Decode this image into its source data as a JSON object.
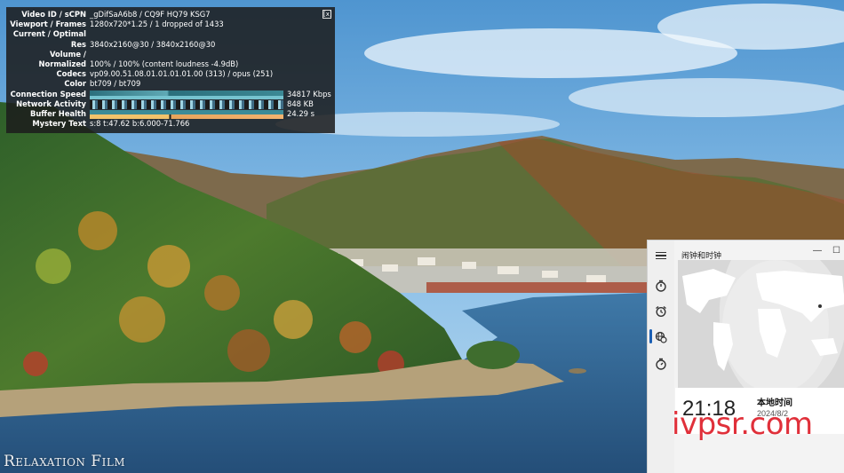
{
  "stats": {
    "close_label": "[x]",
    "rows": [
      {
        "key": "Video ID / sCPN",
        "value": "_gDifSaA6b8 / CQ9F HQ79 KSG7"
      },
      {
        "key": "Viewport / Frames",
        "value": "1280x720*1.25 / 1 dropped of 1433"
      },
      {
        "key": "Current / Optimal",
        "value": ""
      },
      {
        "key": "Res",
        "value": "3840x2160@30 / 3840x2160@30"
      },
      {
        "key": "Volume /",
        "value": ""
      },
      {
        "key": "Normalized",
        "value": "100% / 100% (content loudness -4.9dB)"
      },
      {
        "key": "Codecs",
        "value": "vp09.00.51.08.01.01.01.01.00 (313) / opus (251)"
      },
      {
        "key": "Color",
        "value": "bt709 / bt709"
      }
    ],
    "graph_rows": [
      {
        "key": "Connection Speed",
        "value": "34817 Kbps"
      },
      {
        "key": "Network Activity",
        "value": "848 KB"
      },
      {
        "key": "Buffer Health",
        "value": "24.29 s"
      }
    ],
    "mystery": {
      "key": "Mystery Text",
      "value": "s:8 t:47.62 b:6.000-71.766"
    }
  },
  "watermarks": {
    "film": "Relaxation Film",
    "site": "ivpsr.com"
  },
  "clock_app": {
    "title": "闹钟和时钟",
    "local_time": "21:18",
    "timezone_label": "本地时间",
    "date": "2024/8/2",
    "nav": [
      {
        "name": "timer-icon",
        "glyph": "⏱"
      },
      {
        "name": "alarm-icon",
        "glyph": "⏰"
      },
      {
        "name": "world-clock-icon",
        "glyph": "🌐"
      },
      {
        "name": "stopwatch-icon",
        "glyph": "⏱"
      }
    ],
    "selected_nav": "world-clock-icon"
  }
}
